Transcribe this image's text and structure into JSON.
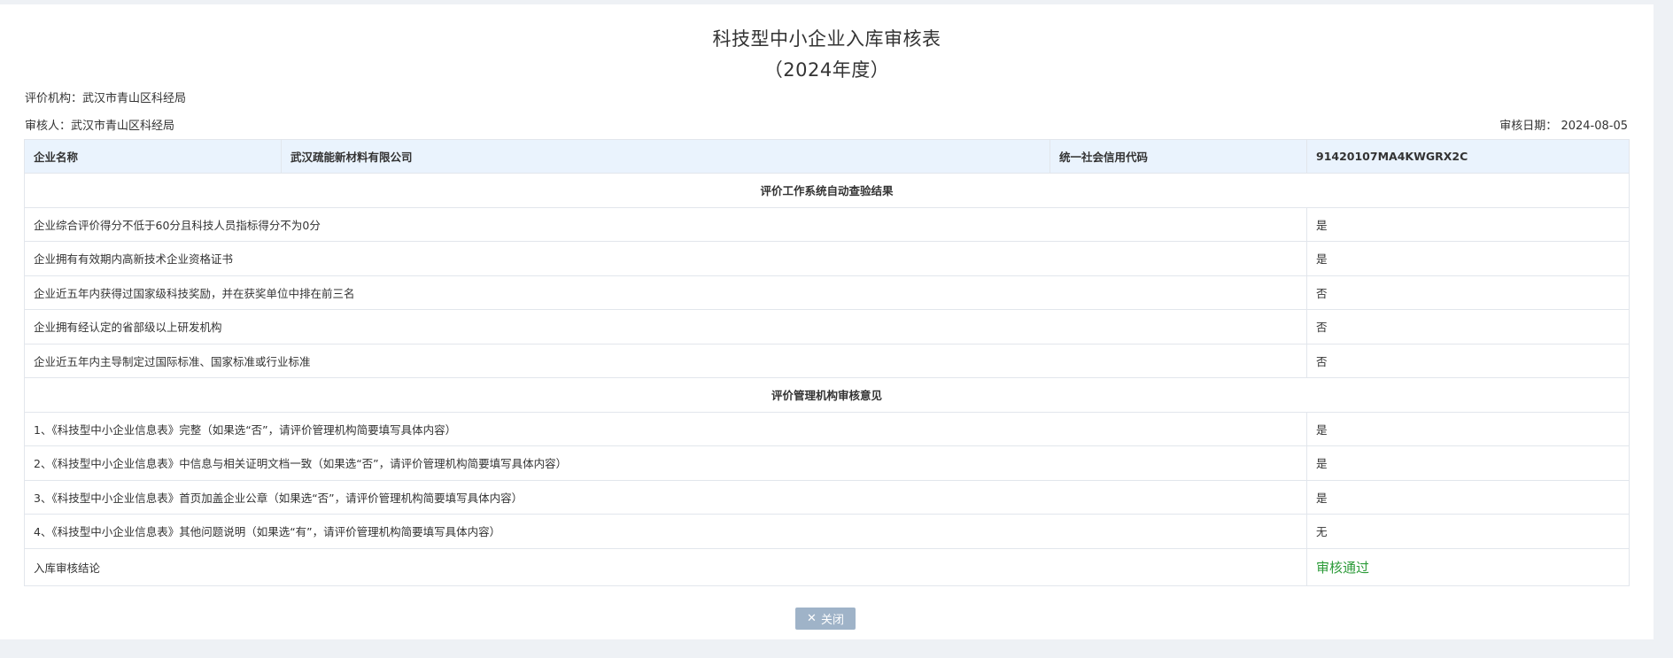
{
  "title": "科技型中小企业入库审核表",
  "subtitle": "（2024年度）",
  "org": {
    "label": "评价机构：",
    "value": "武汉市青山区科经局"
  },
  "reviewer": {
    "label": "审核人：",
    "value": "武汉市青山区科经局"
  },
  "review_date": {
    "label": "审核日期：",
    "value": "2024-08-05"
  },
  "company": {
    "name_label": "企业名称",
    "name_value": "武汉疏能新材料有限公司",
    "credit_label": "统一社会信用代码",
    "credit_value": "91420107MA4KWGRX2C"
  },
  "section_auto": "评价工作系统自动查验结果",
  "auto_rows": [
    {
      "label": "企业综合评价得分不低于60分且科技人员指标得分不为0分",
      "value": "是"
    },
    {
      "label": "企业拥有有效期内高新技术企业资格证书",
      "value": "是"
    },
    {
      "label": "企业近五年内获得过国家级科技奖励，并在获奖单位中排在前三名",
      "value": "否"
    },
    {
      "label": "企业拥有经认定的省部级以上研发机构",
      "value": "否"
    },
    {
      "label": "企业近五年内主导制定过国际标准、国家标准或行业标准",
      "value": "否"
    }
  ],
  "section_manage": "评价管理机构审核意见",
  "manage_rows": [
    {
      "label": "1、《科技型中小企业信息表》完整（如果选“否”，请评价管理机构简要填写具体内容）",
      "value": "是"
    },
    {
      "label": "2、《科技型中小企业信息表》中信息与相关证明文档一致（如果选“否”，请评价管理机构简要填写具体内容）",
      "value": "是"
    },
    {
      "label": "3、《科技型中小企业信息表》首页加盖企业公章（如果选“否”，请评价管理机构简要填写具体内容）",
      "value": "是"
    },
    {
      "label": "4、《科技型中小企业信息表》其他问题说明（如果选“有”，请评价管理机构简要填写具体内容）",
      "value": "无"
    }
  ],
  "conclusion": {
    "label": "入库审核结论",
    "value": "审核通过"
  },
  "close_button": {
    "icon": "close-icon",
    "label": "关闭"
  },
  "colors": {
    "pass": "#2c9b39",
    "header_bg": "#eaf3fd",
    "button_bg": "#9fb3c8"
  }
}
